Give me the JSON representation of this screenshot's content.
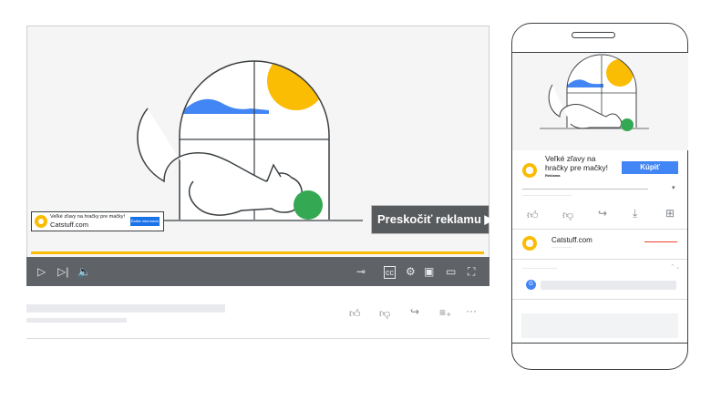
{
  "desktop": {
    "skip_button_label": "Preskočiť reklamu",
    "ad_overlay": {
      "headline": "Veľké zľavy na hračky pre mačky!",
      "domain": "Catstuff.com",
      "cta": "Ďalšie informácie"
    },
    "progress_fraction": 1.0
  },
  "mobile": {
    "ad": {
      "headline_line1": "Veľké zľavy na",
      "headline_line2": "hračky pre mačky!",
      "badge": "Reklama",
      "buy_label": "Kúpiť"
    },
    "channel_name": "Catstuff.com",
    "comment_avatar_letter": "G"
  },
  "colors": {
    "accent": "#fbbc04",
    "blue": "#4285f4",
    "green": "#34a853",
    "controls": "#5f6368"
  }
}
